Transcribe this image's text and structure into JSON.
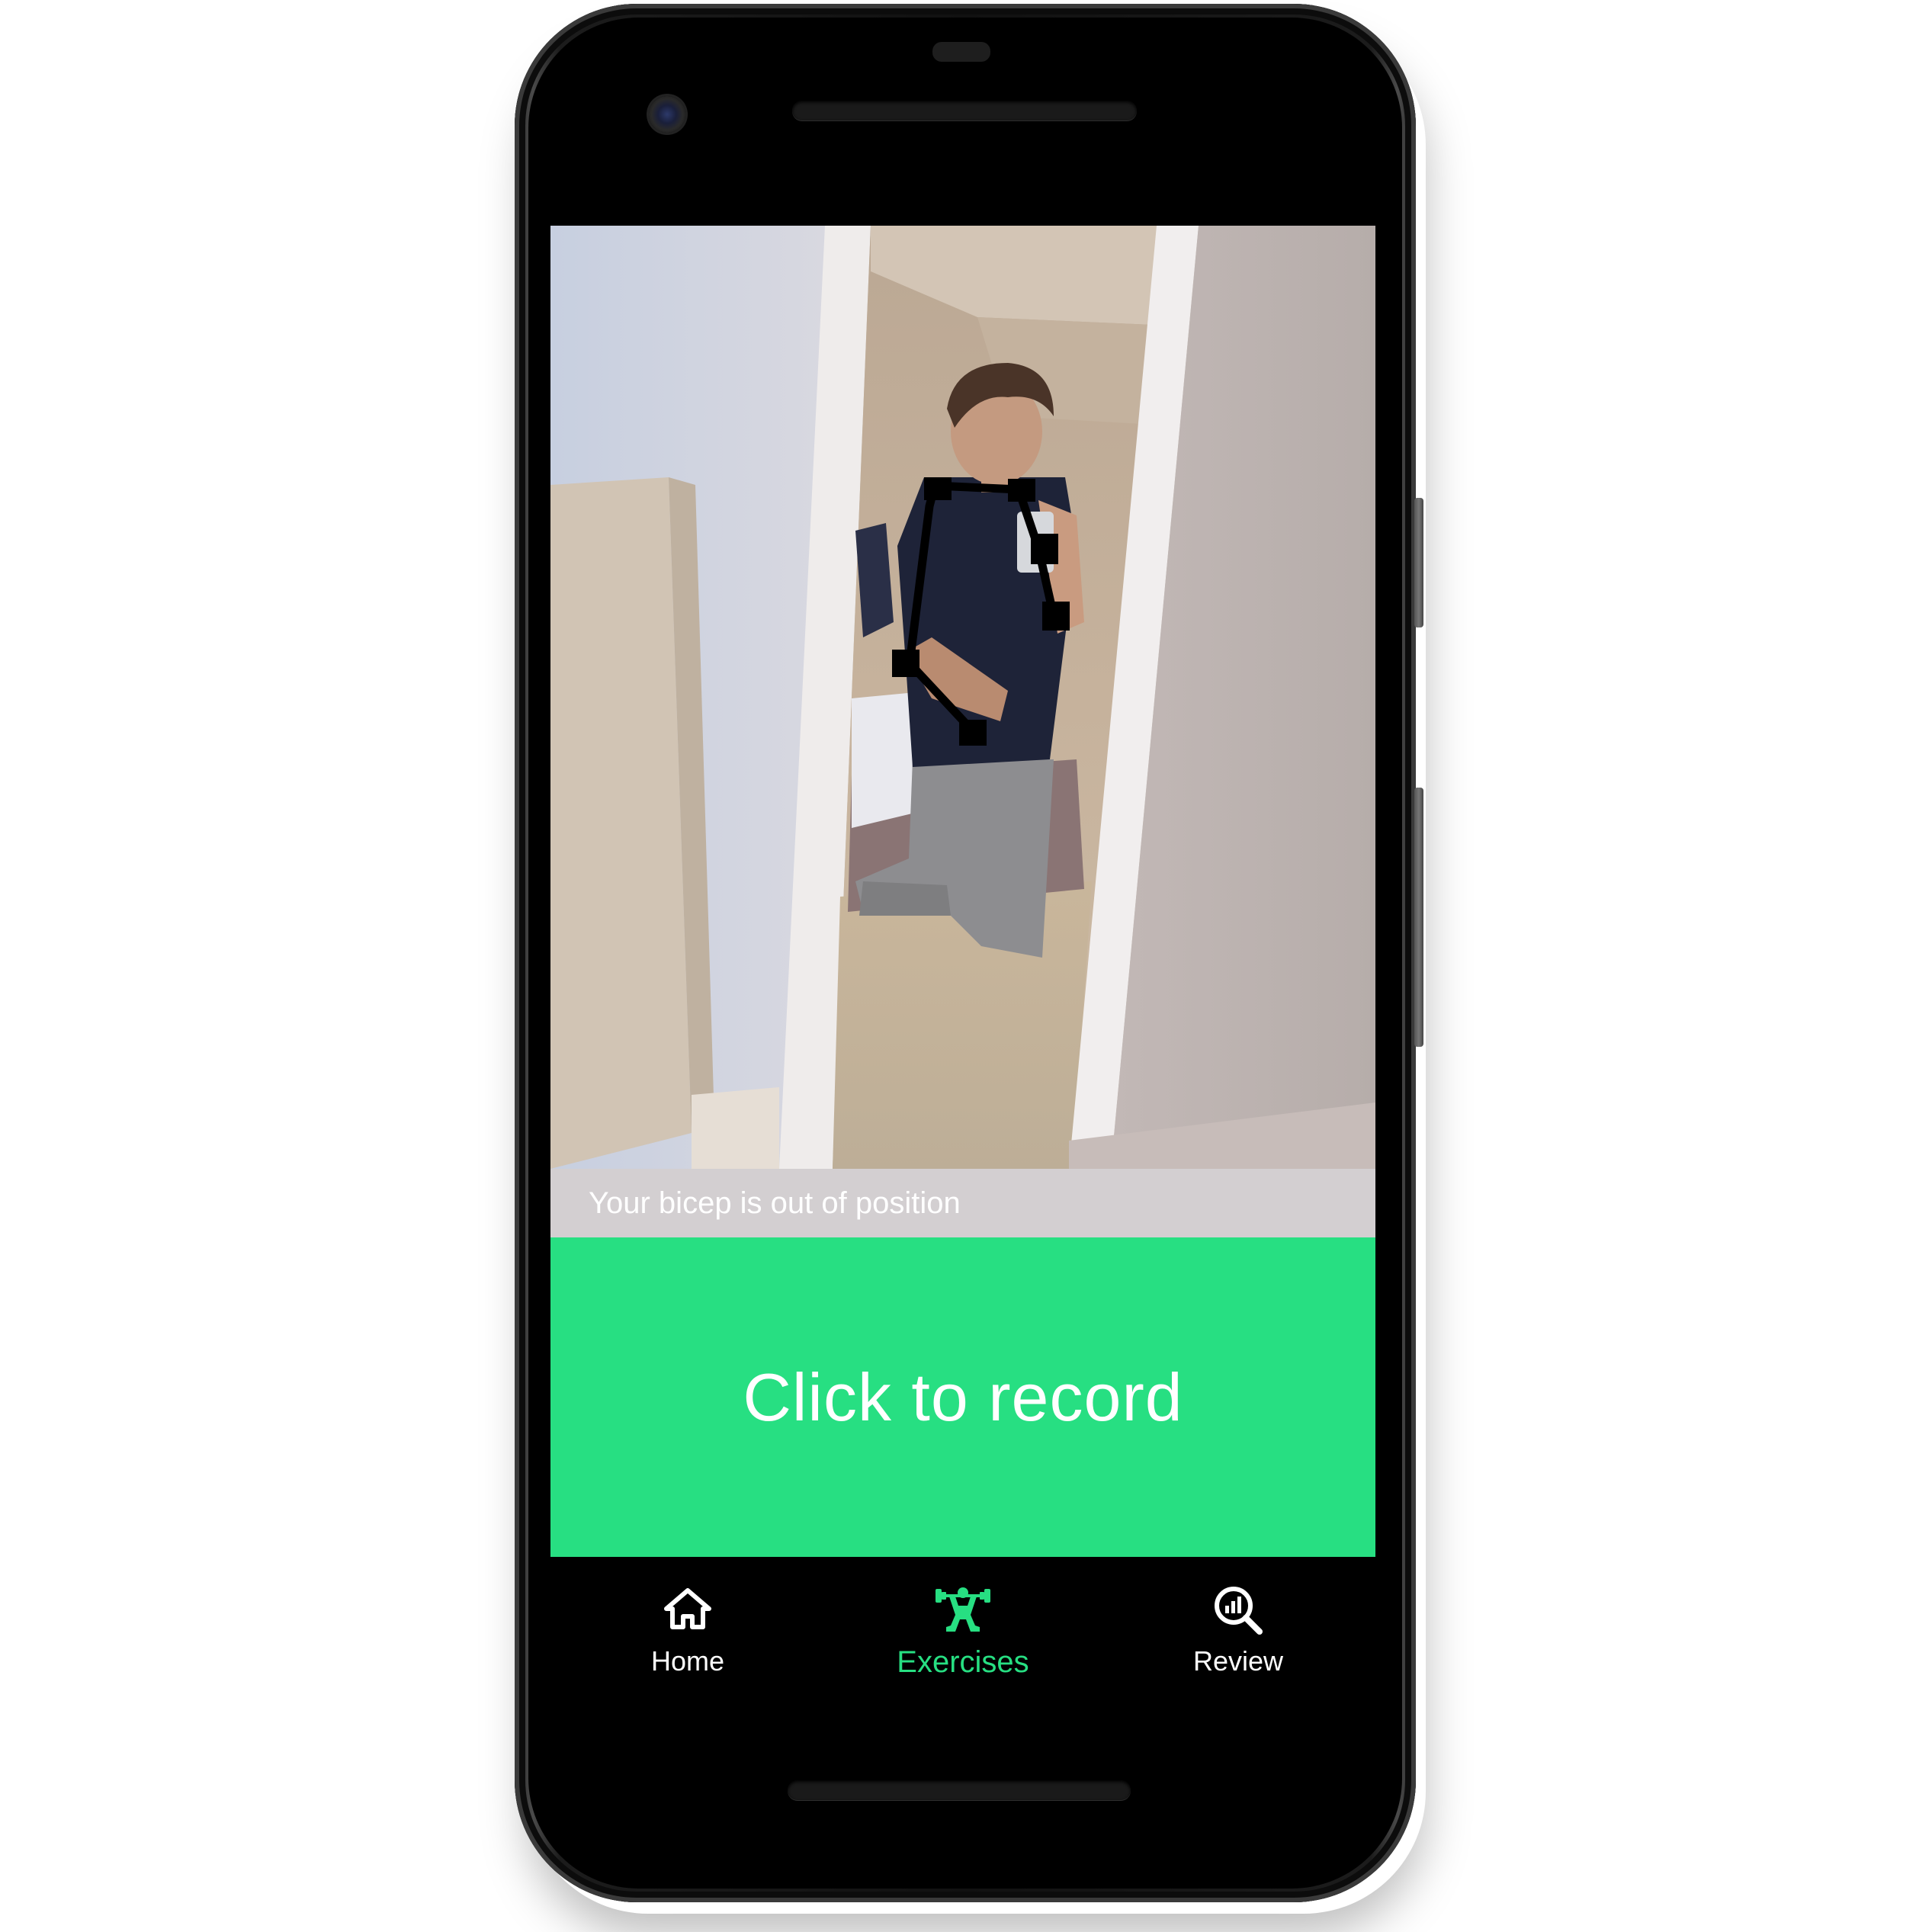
{
  "screen": {
    "feedback_text": "Your bicep is out of position",
    "record_button_label": "Click to record"
  },
  "bottom_nav": {
    "items": [
      {
        "label": "Home",
        "icon": "home-icon",
        "active": false
      },
      {
        "label": "Exercises",
        "icon": "weightlifter-icon",
        "active": true
      },
      {
        "label": "Review",
        "icon": "analytics-search-icon",
        "active": false
      }
    ]
  },
  "colors": {
    "accent": "#27df82",
    "feedback_bar": "#d3cfd1",
    "nav_background": "#000000",
    "nav_label_inactive": "#ffffff"
  }
}
